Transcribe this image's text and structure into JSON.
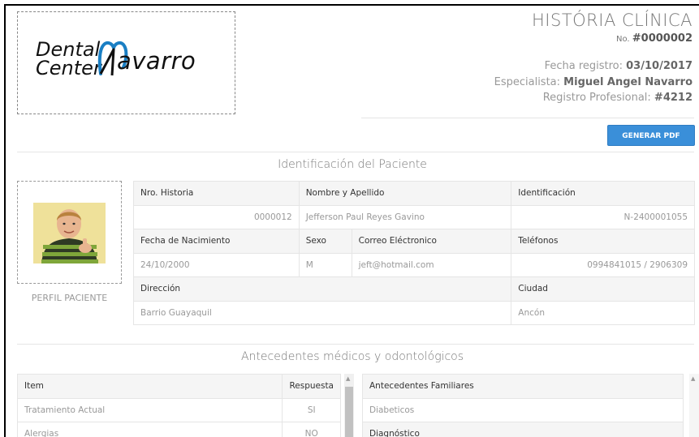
{
  "logo": {
    "line1": "Dental",
    "line2": "Center",
    "brand": "avarro"
  },
  "header": {
    "title": "HISTÓRIA CLÍNICA",
    "number_label": "No.",
    "number": "#0000002",
    "fecha_label": "Fecha registro:",
    "fecha": "03/10/2017",
    "especialista_label": "Especialista:",
    "especialista": "Miguel Angel Navarro",
    "registro_label": "Registro Profesional:",
    "registro": "#4212",
    "pdf_button": "GENERAR PDF"
  },
  "patient_section": {
    "title": "Identificación del Paciente",
    "photo_label": "PERFIL PACIENTE",
    "headers": {
      "historia": "Nro. Historia",
      "nombre": "Nombre y Apellido",
      "identificacion": "Identificación",
      "nacimiento": "Fecha de Nacimiento",
      "sexo": "Sexo",
      "correo": "Correo Eléctronico",
      "telefonos": "Teléfonos",
      "direccion": "Dirección",
      "ciudad": "Ciudad"
    },
    "values": {
      "historia": "0000012",
      "nombre": "Jefferson Paul Reyes Gavino",
      "identificacion": "N-2400001055",
      "nacimiento": "24/10/2000",
      "sexo": "M",
      "correo": "jeft@hotmail.com",
      "telefonos": "0994841015 / 2906309",
      "direccion": "Barrio Guayaquil",
      "ciudad": "Ancón"
    }
  },
  "antecedentes": {
    "title": "Antecedentes médicos y odontológicos",
    "columns": [
      "Item",
      "Respuesta"
    ],
    "rows": [
      {
        "item": "Tratamiento Actual",
        "respuesta": "SI"
      },
      {
        "item": "Alergias",
        "respuesta": "NO"
      }
    ],
    "familiares_header": "Antecedentes Familiares",
    "familiares_value": "Diabeticos",
    "diagnostico_header": "Diagnóstico"
  },
  "colors": {
    "accent": "#3a8fd9",
    "logo_blue": "#1a7fc4"
  }
}
